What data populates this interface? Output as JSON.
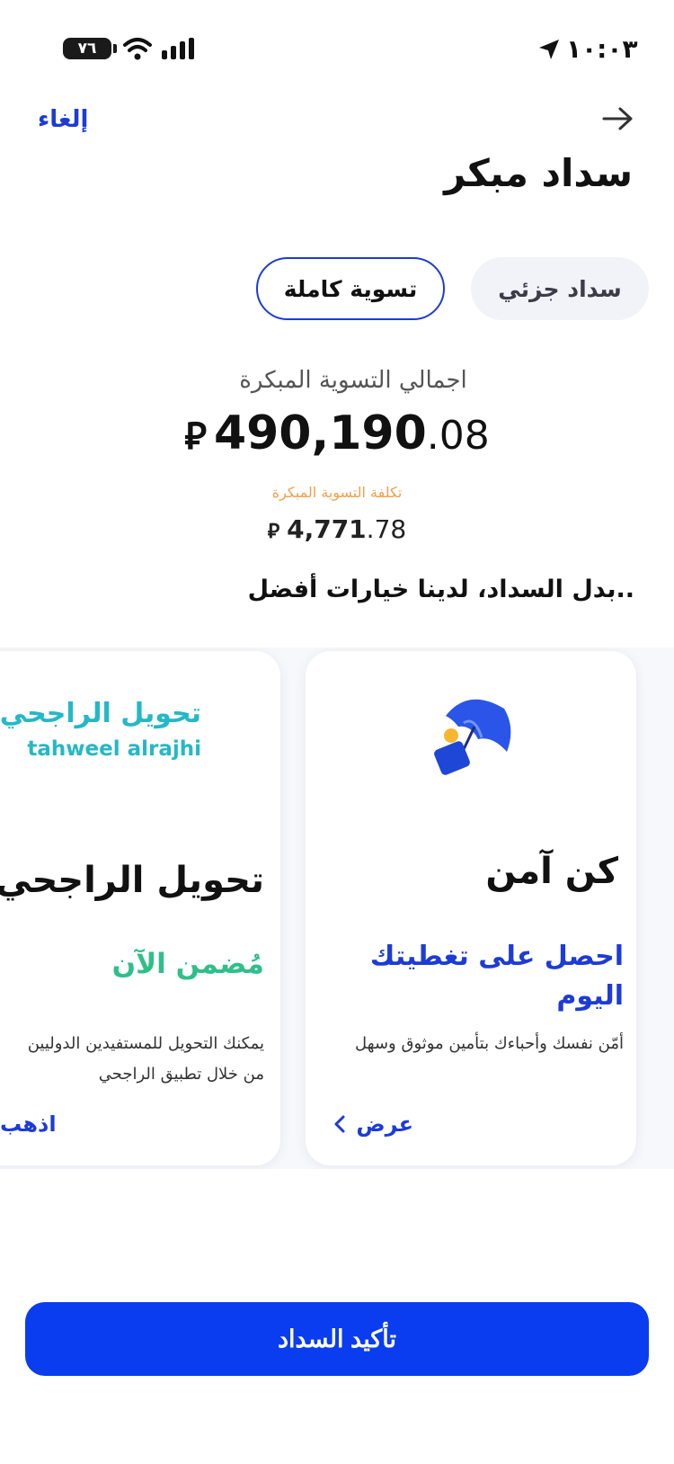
{
  "status_bar": {
    "battery": "٧٦",
    "time": "١٠:٠٣"
  },
  "header": {
    "cancel_label": "إلغاء",
    "title": "سداد مبكر"
  },
  "tabs": [
    {
      "label": "سداد جزئي",
      "selected": false
    },
    {
      "label": "تسوية كاملة",
      "selected": true
    }
  ],
  "settlement": {
    "total_label": "اجمالي التسوية المبكرة",
    "total_integer": "490,190",
    "total_decimal": ".08",
    "currency_symbol": "⃁",
    "cost_label": "تكلفة التسوية المبكرة",
    "cost_integer": "4,771",
    "cost_decimal": ".78"
  },
  "options_heading": "..بدل السداد، لدينا خيارات أفضل",
  "cards": {
    "protect": {
      "icon": "umbrella-wallet-icon",
      "title": "كن آمن",
      "subtitle": "احصل على تغطيتك اليوم",
      "description": "أمّن نفسك وأحباءك بتأمين موثوق وسهل",
      "link_label": "عرض"
    },
    "transfer": {
      "brand_ar": "تحويل الراجحي",
      "brand_en": "tahweel alrajhi",
      "title": "تحويل الراجحي",
      "subtitle": "مُضمن الآن",
      "description_line1": "يمكنك التحويل للمستفيدين الدوليين",
      "description_line2": "من خلال تطبيق الراجحي",
      "link_label": "اذهب"
    }
  },
  "confirm_label": "تأكيد السداد",
  "colors": {
    "accent": "#1d3bd6",
    "button": "#0a3cf0",
    "cost_label": "#f0a04b",
    "brand_teal": "#25b8c6",
    "success_green": "#2fbf8a"
  }
}
